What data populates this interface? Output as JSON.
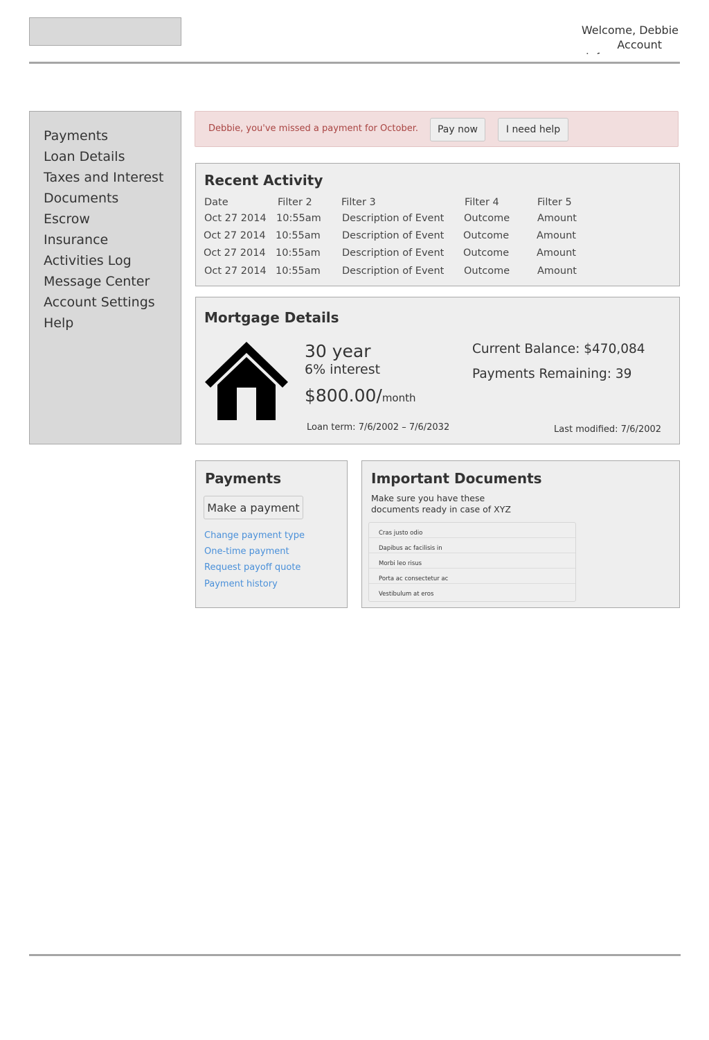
{
  "header": {
    "welcome": "Welcome, Debbie",
    "account_link": "Account",
    "account_clip": "Inf"
  },
  "sidebar": {
    "items": [
      {
        "label": "Payments"
      },
      {
        "label": "Loan Details"
      },
      {
        "label": "Taxes and Interest"
      },
      {
        "label": "Documents"
      },
      {
        "label": "Escrow"
      },
      {
        "label": "Insurance"
      },
      {
        "label": "Activities Log"
      },
      {
        "label": "Message Center"
      },
      {
        "label": "Account Settings"
      },
      {
        "label": "Help"
      }
    ]
  },
  "alert": {
    "message": "Debbie, you've missed a payment for October.",
    "pay_now": "Pay now",
    "help": "I need help"
  },
  "recent_activity": {
    "title": "Recent Activity",
    "headers": [
      "Date",
      "Filter 2",
      "Filter 3",
      "Filter 4",
      "Filter 5"
    ],
    "rows": [
      [
        "Oct 27 2014",
        "10:55am",
        "Description of Event",
        "Outcome",
        "Amount"
      ],
      [
        "Oct 27 2014",
        "10:55am",
        "Description of Event",
        "Outcome",
        "Amount"
      ],
      [
        "Oct 27 2014",
        "10:55am",
        "Description of Event",
        "Outcome",
        "Amount"
      ],
      [
        "Oct 27 2014",
        "10:55am",
        "Description of Event",
        "Outcome",
        "Amount"
      ]
    ]
  },
  "mortgage": {
    "title": "Mortgage Details",
    "icon": "house-icon",
    "term": "30 year",
    "interest": "6% interest",
    "amount": "$800.00/",
    "per": "month",
    "current_balance": "Current Balance: $470,084",
    "payments_remaining": "Payments Remaining:  39",
    "loan_term": "Loan term: 7/6/2002 – 7/6/2032",
    "last_modified": "Last modified: 7/6/2002"
  },
  "payments": {
    "title": "Payments",
    "make_payment": "Make a payment",
    "links": [
      {
        "label": "Change payment type"
      },
      {
        "label": "One-time payment"
      },
      {
        "label": "Request payoff quote"
      },
      {
        "label": "Payment history"
      }
    ]
  },
  "documents": {
    "title": "Important Documents",
    "description": "Make sure you have these documents ready in case of XYZ",
    "items": [
      {
        "label": "Cras justo odio"
      },
      {
        "label": "Dapibus ac facilisis in"
      },
      {
        "label": "Morbi leo risus"
      },
      {
        "label": "Porta ac consectetur ac"
      },
      {
        "label": "Vestibulum at eros"
      }
    ]
  },
  "colors": {
    "alert_bg": "#f2dede",
    "alert_text": "#a94442",
    "link": "#4a90d9",
    "panel_bg": "#eeeeee",
    "sidebar_bg": "#d9d9d9"
  }
}
